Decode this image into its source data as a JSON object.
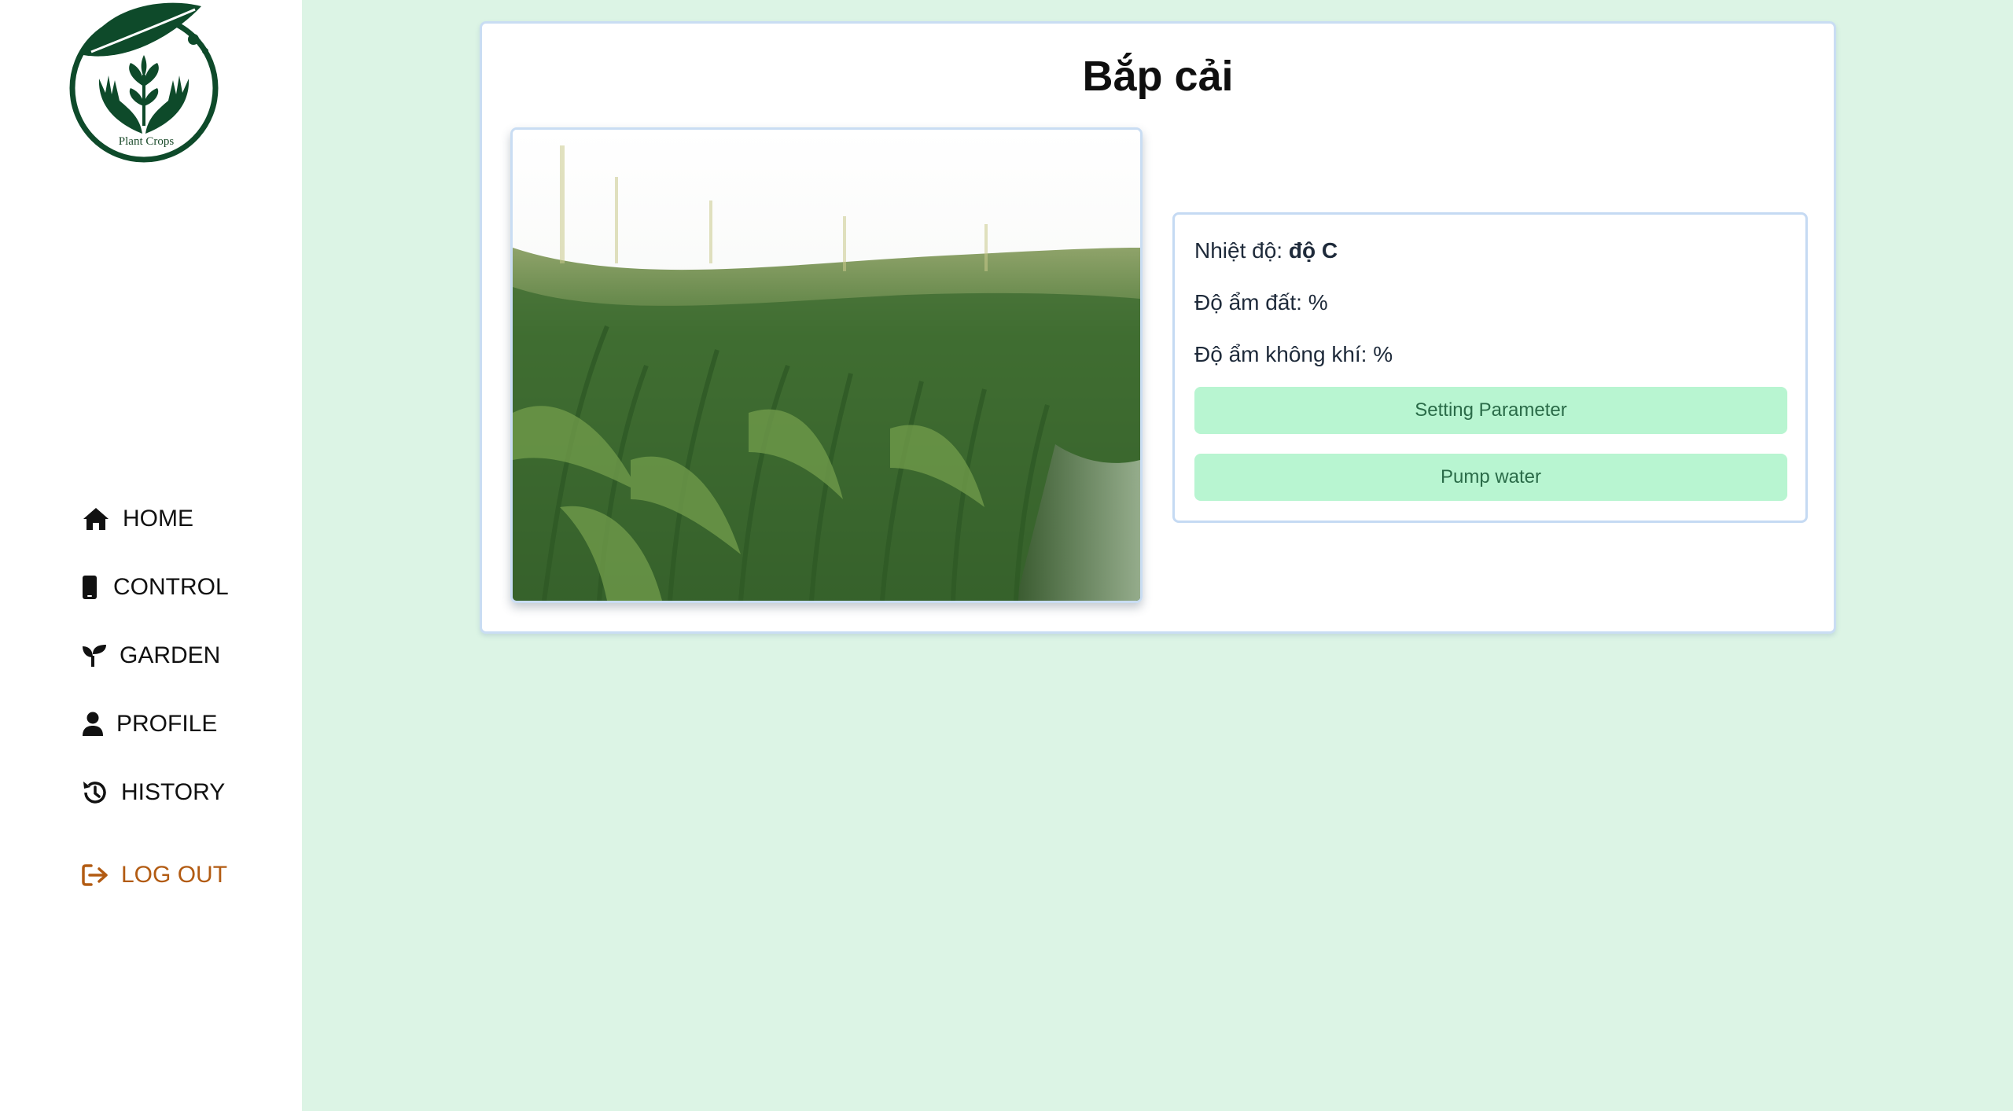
{
  "logo": {
    "text": "Plant Crops",
    "icon": "leaf-hands-logo"
  },
  "nav": {
    "items": [
      {
        "label": "HOME",
        "icon": "home-icon"
      },
      {
        "label": "CONTROL",
        "icon": "mobile-icon"
      },
      {
        "label": "GARDEN",
        "icon": "seedling-icon"
      },
      {
        "label": "PROFILE",
        "icon": "user-icon"
      },
      {
        "label": "HISTORY",
        "icon": "history-icon"
      }
    ],
    "logout": {
      "label": "LOG OUT",
      "icon": "logout-icon"
    }
  },
  "plant": {
    "title": "Bắp cải",
    "image_alt": "corn field photo",
    "temperature_label": "Nhiệt độ: ",
    "temperature_value": "độ C",
    "soil_humidity": "Độ ẩm đất: %",
    "air_humidity": "Độ ẩm không khí: %"
  },
  "actions": {
    "setting_label": "Setting Parameter",
    "pump_label": "Pump water"
  },
  "colors": {
    "background": "#dcf4e5",
    "logo_green": "#0e4a2a",
    "button_bg": "#b8f5d1",
    "button_text": "#2a6b48",
    "logout": "#b25b12",
    "border": "#c9ddf3"
  }
}
